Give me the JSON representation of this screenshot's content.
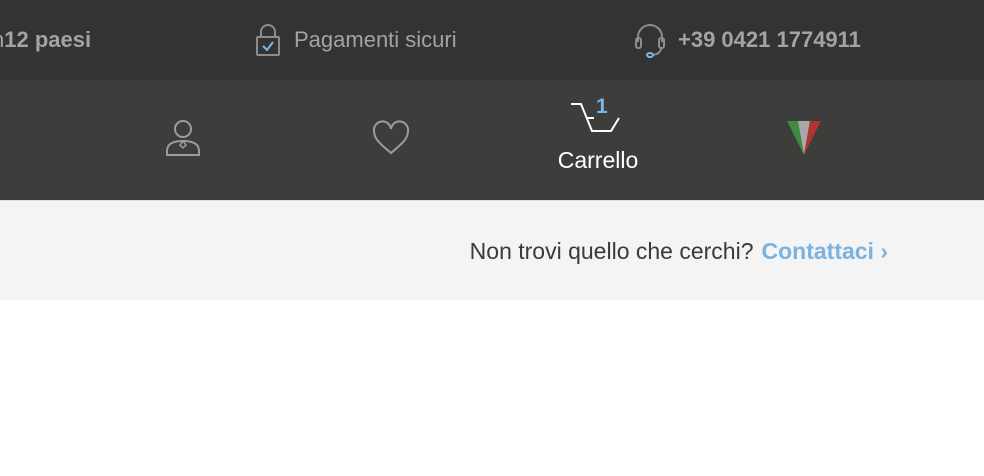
{
  "topbar": {
    "shipping_prefix": "n ",
    "shipping_bold": "12 paesi",
    "payments": "Pagamenti sicuri",
    "phone": "+39 0421 1774911"
  },
  "nav": {
    "cart_count": "1",
    "cart_label": "Carrello"
  },
  "info": {
    "text": "Non trovi quello che cerchi?",
    "link": "Contattaci ›"
  },
  "colors": {
    "topbar_bg": "#333333",
    "navbar_bg": "#3d3d3c",
    "accent": "#7ab6e6",
    "flag_green": "#3f8a3f",
    "flag_red": "#b23232"
  },
  "icons": [
    "lock-check-icon",
    "headset-icon",
    "user-icon",
    "heart-icon",
    "cart-icon",
    "italy-flag-icon"
  ]
}
